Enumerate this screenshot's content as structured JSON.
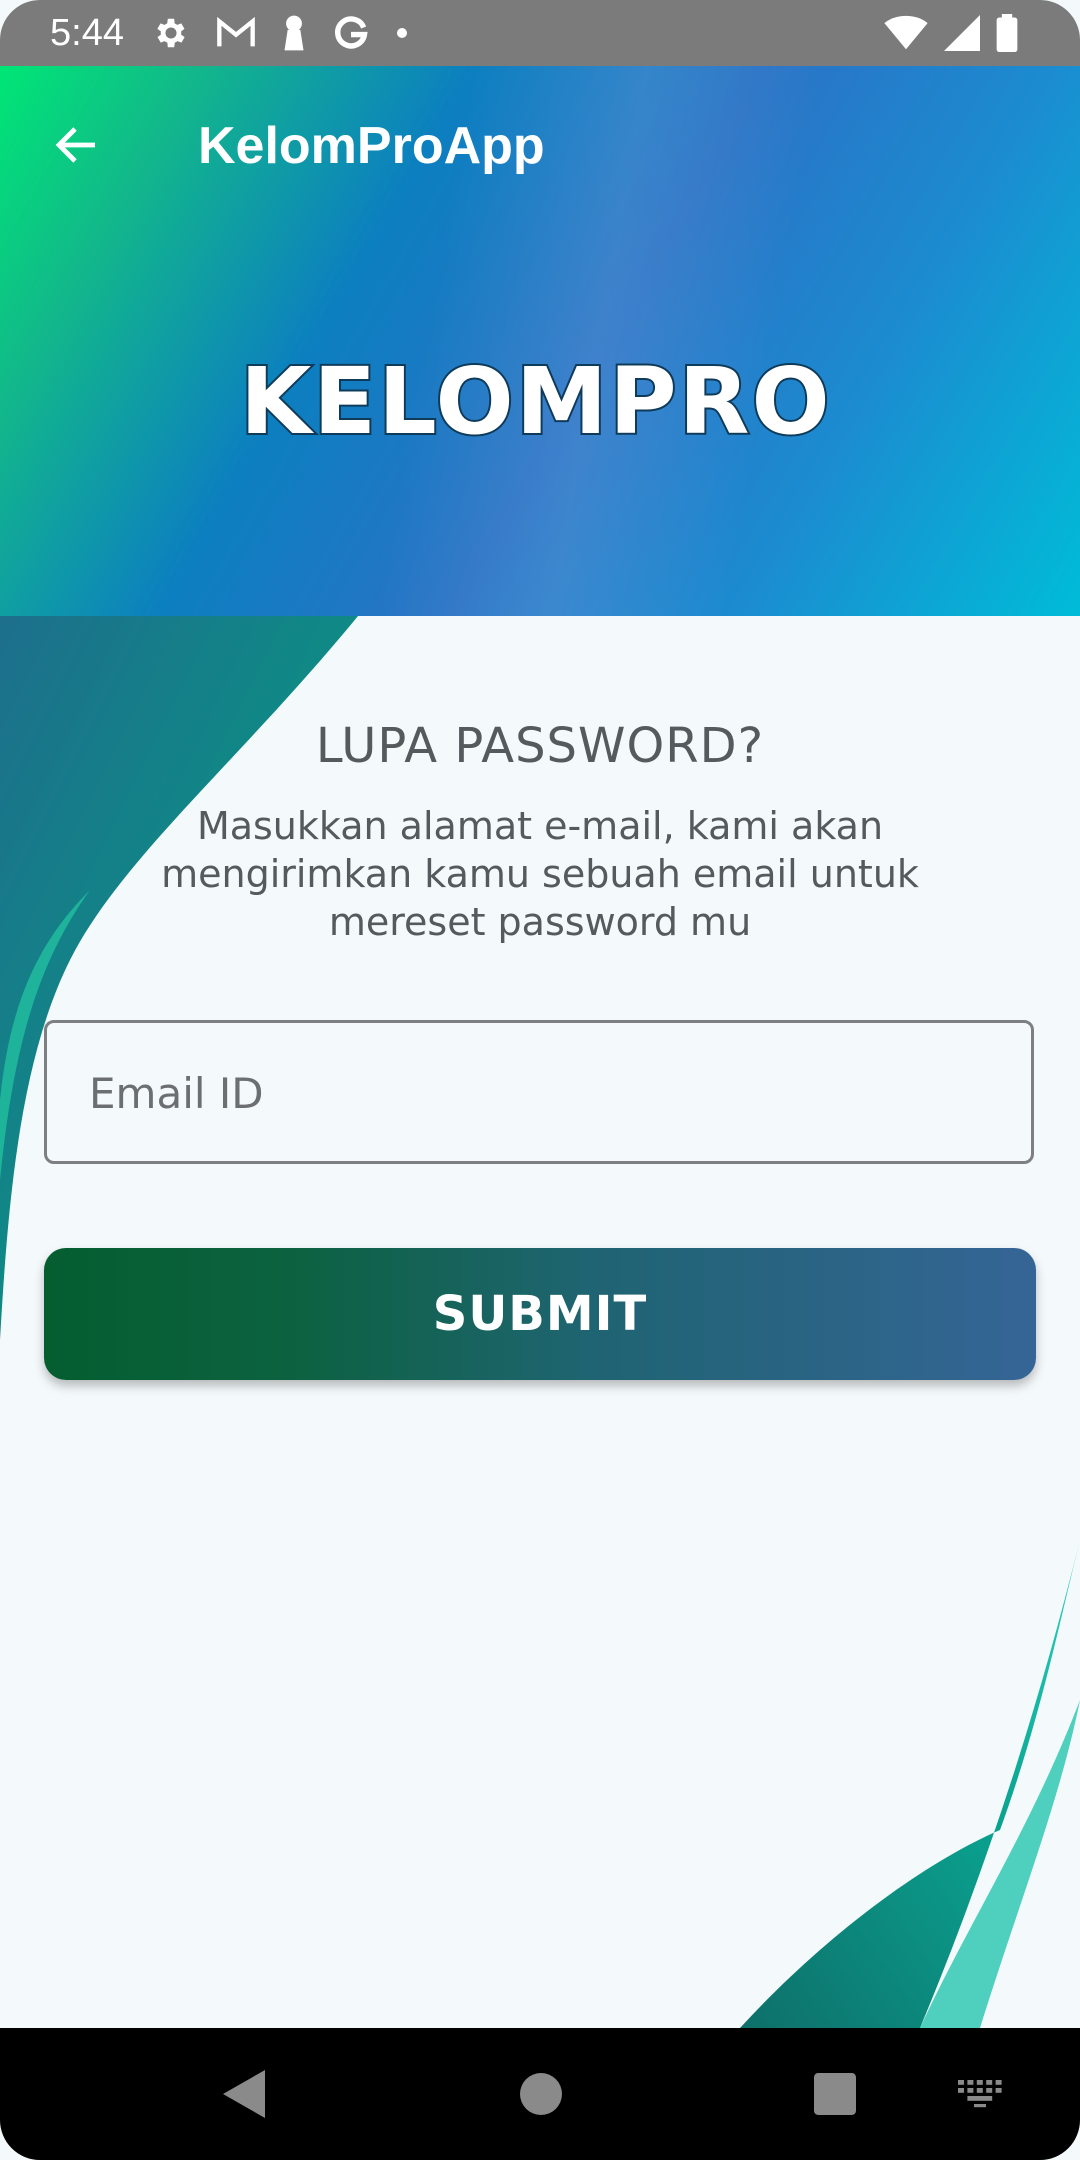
{
  "status_bar": {
    "time": "5:44",
    "left_icons": [
      "settings-icon",
      "gmail-icon",
      "keyhole-icon",
      "google-icon",
      "dot-icon"
    ],
    "right_icons": [
      "wifi-icon",
      "signal-icon",
      "battery-icon"
    ]
  },
  "toolbar": {
    "title": "KelomProApp",
    "back_icon": "arrow-left-icon"
  },
  "brand": {
    "logo_text": "KELOMPRO"
  },
  "form": {
    "heading": "LUPA PASSWORD?",
    "description": "Masukkan alamat e-mail, kami akan mengirimkan kamu sebuah email untuk mereset password mu",
    "email_placeholder": "Email ID",
    "email_value": "",
    "submit_label": "SUBMIT"
  },
  "nav_bar": {
    "buttons": [
      "back-triangle-icon",
      "home-circle-icon",
      "recents-square-icon",
      "keyboard-icon"
    ]
  },
  "colors": {
    "header_gradient_start": "#00e676",
    "header_gradient_mid": "#2a73c6",
    "header_gradient_end": "#00bcd8",
    "submit_gradient_start": "#045e30",
    "submit_gradient_end": "#356596",
    "background": "#f4f9fb",
    "text": "#555a5e"
  }
}
